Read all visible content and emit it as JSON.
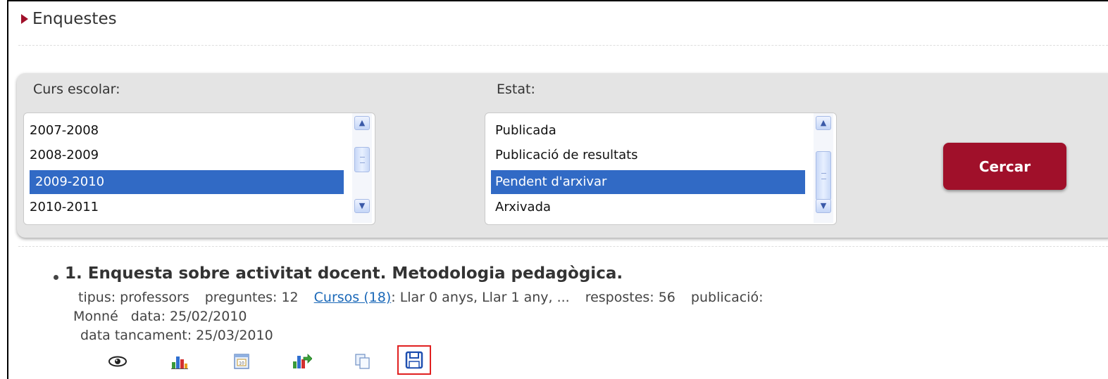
{
  "section": {
    "title": "Enquestes"
  },
  "filters": {
    "course_label": "Curs escolar:",
    "course_options": [
      {
        "label": "2007-2008",
        "selected": false
      },
      {
        "label": "2008-2009",
        "selected": false
      },
      {
        "label": "2009-2010",
        "selected": true
      },
      {
        "label": "2010-2011",
        "selected": false
      }
    ],
    "state_label": "Estat:",
    "state_options": [
      {
        "label": "Publicada",
        "selected": false
      },
      {
        "label": "Publicació de resultats",
        "selected": false
      },
      {
        "label": "Pendent d'arxivar",
        "selected": true
      },
      {
        "label": "Arxivada",
        "selected": false
      }
    ],
    "search_button": "Cercar"
  },
  "results": [
    {
      "title": "1. Enquesta sobre activitat docent. Metodologia pedagògica.",
      "type_label": "tipus:",
      "type_value": "professors",
      "questions_label": "preguntes:",
      "questions_value": "12",
      "courses_link": "Cursos (18)",
      "courses_list": ": Llar 0 anys, Llar 1 any, ...",
      "responses_label": "respostes:",
      "responses_value": "56",
      "publication_label": "publicació:",
      "publication_value": "Monné",
      "date_label": "data:",
      "date_value": "25/02/2010",
      "close_date_label": "data tancament:",
      "close_date_value": "25/03/2010",
      "actions": [
        {
          "icon": "eye-icon"
        },
        {
          "icon": "bar-chart-icon"
        },
        {
          "icon": "calendar-icon"
        },
        {
          "icon": "chart-export-icon"
        },
        {
          "icon": "copy-icon"
        },
        {
          "icon": "save-icon",
          "highlighted": true
        }
      ]
    }
  ],
  "colors": {
    "accent": "#a0102a",
    "selection": "#316ac5",
    "link": "#1a68b8",
    "highlight": "#e02020"
  }
}
